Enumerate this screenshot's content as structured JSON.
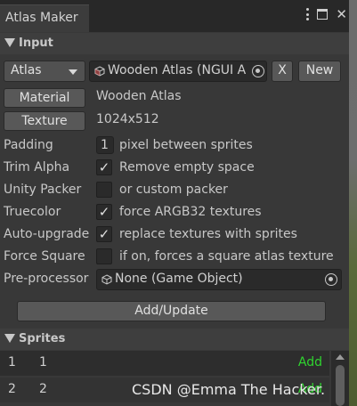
{
  "window": {
    "tab_title": "Atlas Maker"
  },
  "input_section": {
    "title": "Input",
    "atlas_type": "Atlas",
    "atlas_object": "Wooden Atlas (NGUI A",
    "clear_label": "X",
    "new_label": "New",
    "material_button": "Material",
    "material_value": "Wooden Atlas",
    "texture_button": "Texture",
    "texture_value": "1024x512",
    "rows": [
      {
        "label": "Padding",
        "field": "1",
        "text": "pixel between sprites"
      },
      {
        "label": "Trim Alpha",
        "checked": true,
        "text": "Remove empty space"
      },
      {
        "label": "Unity Packer",
        "checked": false,
        "text": "or custom packer"
      },
      {
        "label": "Truecolor",
        "checked": true,
        "text": "force ARGB32 textures"
      },
      {
        "label": "Auto-upgrade",
        "checked": true,
        "text": "replace textures with sprites"
      },
      {
        "label": "Force Square",
        "checked": false,
        "text": "if on, forces a square atlas texture"
      }
    ],
    "preprocessor_label": "Pre-processor",
    "preprocessor_value": "None (Game Object)",
    "add_update_button": "Add/Update"
  },
  "sprites_section": {
    "title": "Sprites",
    "items": [
      {
        "index": "1",
        "name": "1",
        "action": "Add"
      },
      {
        "index": "2",
        "name": "2",
        "action": "Add"
      }
    ]
  },
  "watermark": "CSDN @Emma The Hacker.",
  "colors": {
    "add_action": "#2fd42f",
    "panel_bg": "#383838",
    "title_bar": "#282828"
  },
  "icons": {
    "checkmark": "✓",
    "close": "✕",
    "object_picker": "object-picker-icon",
    "cube": "cube-icon"
  }
}
